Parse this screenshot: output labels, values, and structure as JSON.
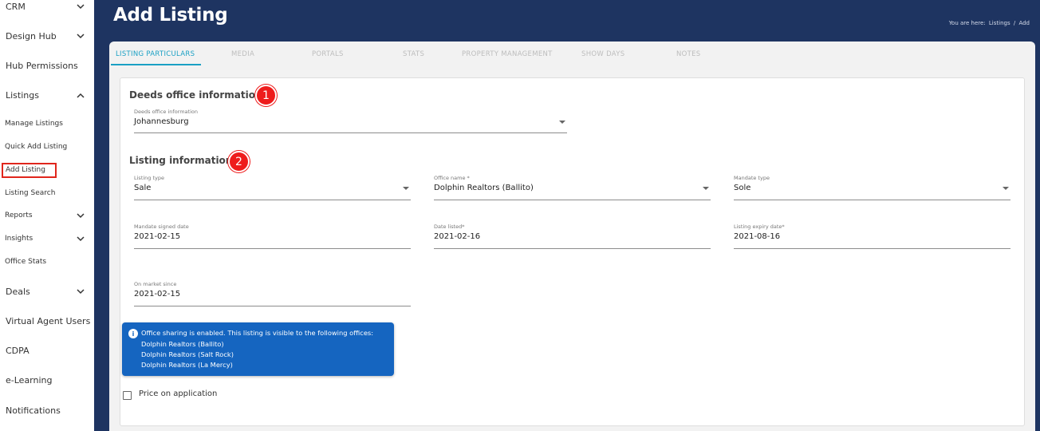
{
  "sidebar": {
    "items": [
      {
        "label": "CRM"
      },
      {
        "label": "Design Hub"
      },
      {
        "label": "Hub Permissions"
      },
      {
        "label": "Listings"
      },
      {
        "label": "Manage Listings"
      },
      {
        "label": "Quick Add Listing"
      },
      {
        "label": "Add Listing"
      },
      {
        "label": "Listing Search"
      },
      {
        "label": "Reports"
      },
      {
        "label": "Insights"
      },
      {
        "label": "Office Stats"
      },
      {
        "label": "Deals"
      },
      {
        "label": "Virtual Agent Users"
      },
      {
        "label": "CDPA"
      },
      {
        "label": "e-Learning"
      },
      {
        "label": "Notifications"
      }
    ]
  },
  "header": {
    "title": "Add Listing",
    "breadcrumb": {
      "prefix": "You are here:",
      "items": [
        "Listings",
        "/",
        "Add"
      ]
    }
  },
  "tabs": [
    {
      "label": "LISTING PARTICULARS",
      "active": true
    },
    {
      "label": "MEDIA"
    },
    {
      "label": "PORTALS"
    },
    {
      "label": "STATS"
    },
    {
      "label": "PROPERTY MANAGEMENT"
    },
    {
      "label": "SHOW DAYS"
    },
    {
      "label": "NOTES"
    }
  ],
  "deeds": {
    "title": "Deeds office information",
    "badge": "1",
    "field": {
      "label": "Deeds office information",
      "value": "Johannesburg"
    }
  },
  "listing": {
    "title": "Listing information",
    "badge": "2",
    "listing_type": {
      "label": "Listing type",
      "value": "Sale"
    },
    "office_name": {
      "label": "Office name *",
      "value": "Dolphin Realtors (Ballito)"
    },
    "mandate_type": {
      "label": "Mandate type",
      "value": "Sole"
    },
    "mandate_signed_date": {
      "label": "Mandate signed date",
      "value": "2021-02-15"
    },
    "date_listed": {
      "label": "Date listed*",
      "value": "2021-02-16"
    },
    "listing_expiry_date": {
      "label": "Listing expiry date*",
      "value": "2021-08-16"
    },
    "on_market_since": {
      "label": "On market since",
      "value": "2021-02-15"
    }
  },
  "info": {
    "icon": "info-icon",
    "text": "Office sharing is enabled. This listing is visible to the following offices:",
    "offices": [
      "Dolphin Realtors (Ballito)",
      "Dolphin Realtors (Salt Rock)",
      "Dolphin Realtors (La Mercy)"
    ]
  },
  "price_on_application": {
    "label": "Price on application",
    "checked": false
  },
  "colors": {
    "header_bg": "#1e3461",
    "accent": "#1aa0c4",
    "info_bg": "#1565c0",
    "badge": "#ee1c1c",
    "highlight_border": "#e0261c"
  }
}
